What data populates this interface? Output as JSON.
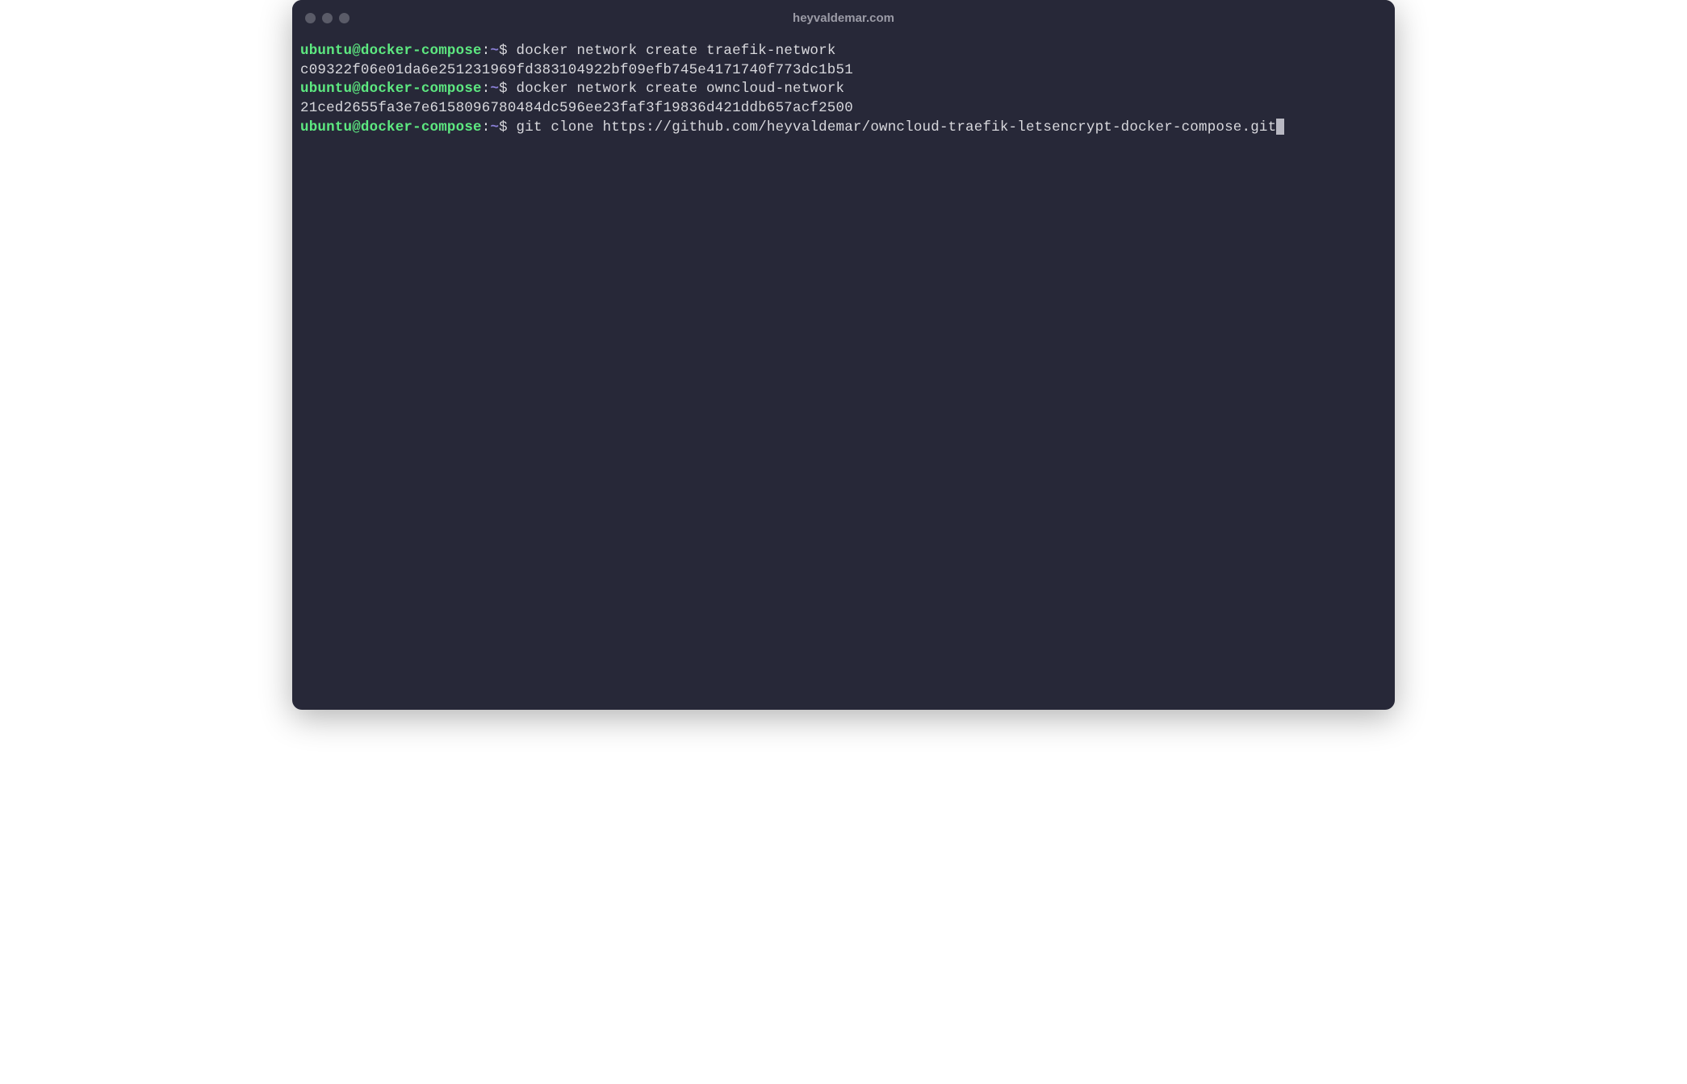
{
  "window": {
    "title": "heyvaldemar.com"
  },
  "prompt": {
    "userhost": "ubuntu@docker-compose",
    "colon": ":",
    "path": "~",
    "symbol": "$"
  },
  "lines": [
    {
      "type": "command",
      "text": " docker network create traefik-network"
    },
    {
      "type": "output",
      "text": "c09322f06e01da6e251231969fd383104922bf09efb745e4171740f773dc1b51"
    },
    {
      "type": "command",
      "text": " docker network create owncloud-network"
    },
    {
      "type": "output",
      "text": "21ced2655fa3e7e6158096780484dc596ee23faf3f19836d421ddb657acf2500"
    },
    {
      "type": "command",
      "text": " git clone https://github.com/heyvaldemar/owncloud-traefik-letsencrypt-docker-compose.git",
      "cursor": true
    }
  ]
}
